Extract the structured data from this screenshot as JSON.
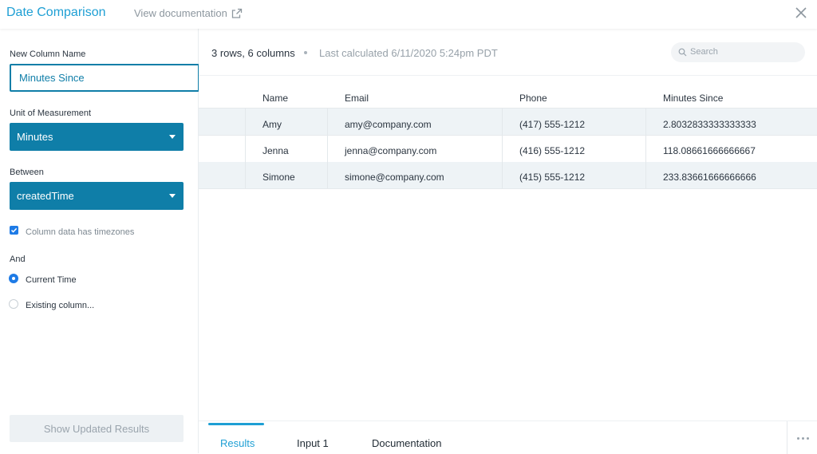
{
  "header": {
    "title": "Date Comparison",
    "docs_link": "View documentation",
    "icons": {
      "external": "external-link-icon",
      "close": "close-icon"
    }
  },
  "sidebar": {
    "new_column_label": "New Column Name",
    "new_column_value": "Minutes Since",
    "unit_label": "Unit of Measurement",
    "unit_value": "Minutes",
    "between_label": "Between",
    "between_value": "createdTime",
    "timezone_checkbox": "Column data has timezones",
    "and_label": "And",
    "radio_current": "Current Time",
    "radio_existing": "Existing column...",
    "show_button": "Show Updated Results"
  },
  "main": {
    "summary": "3 rows, 6 columns",
    "last_calculated": "Last calculated 6/11/2020 5:24pm PDT",
    "search_placeholder": "Search",
    "columns": [
      "Name",
      "Email",
      "Phone",
      "Minutes Since"
    ],
    "rows": [
      [
        "Amy",
        "amy@company.com",
        "(417) 555-1212",
        "2.8032833333333333"
      ],
      [
        "Jenna",
        "jenna@company.com",
        "(416) 555-1212",
        "118.08661666666667"
      ],
      [
        "Simone",
        "simone@company.com",
        "(415) 555-1212",
        "233.83661666666666"
      ]
    ]
  },
  "tabs": [
    "Results",
    "Input 1",
    "Documentation"
  ],
  "colors": {
    "accent": "#1e9fd4",
    "select_bg": "#0f7ea8",
    "checkbox": "#1e7be6",
    "alt_row": "#eef3f6"
  }
}
